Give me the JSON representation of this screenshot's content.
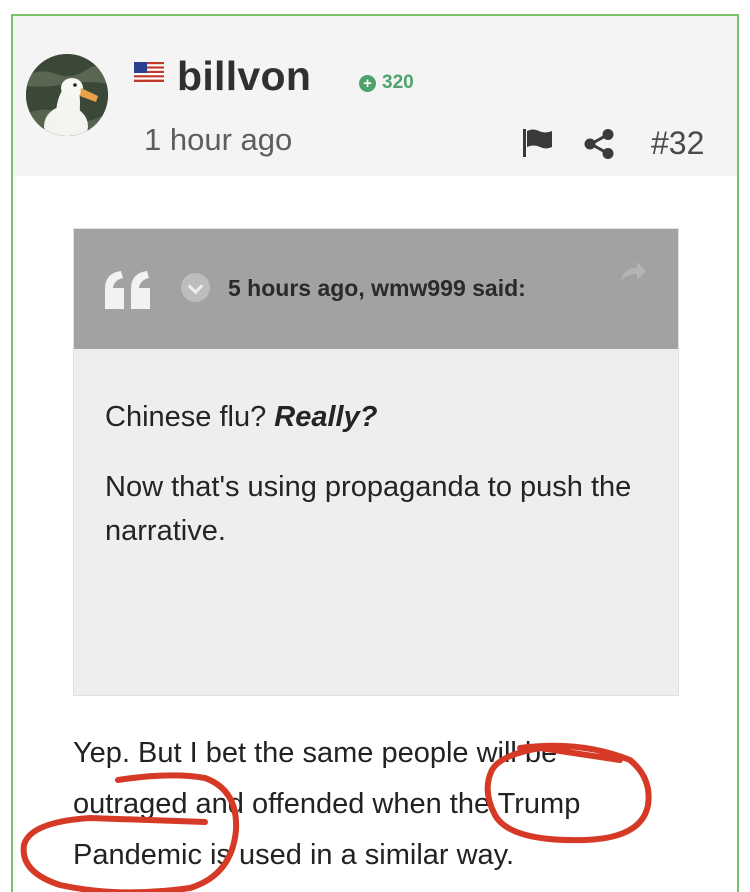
{
  "post": {
    "username": "billvon",
    "reputation": "320",
    "time_ago": "1 hour ago",
    "post_number": "#32",
    "flag_icon": "us-flag-icon",
    "border_color": "#7ac36a",
    "reputation_color": "#4fa36a"
  },
  "quote": {
    "attribution": "5 hours ago, wmw999 said:",
    "line1_text": "Chinese flu? ",
    "line1_emphasis": "Really?",
    "line2": "Now that's using propaganda to push the narrative."
  },
  "reply": {
    "text": "Yep.  But I bet the same people will be outraged and offended when the Trump Pandemic is used in a similar way."
  },
  "annotation_color": "#d63a26"
}
